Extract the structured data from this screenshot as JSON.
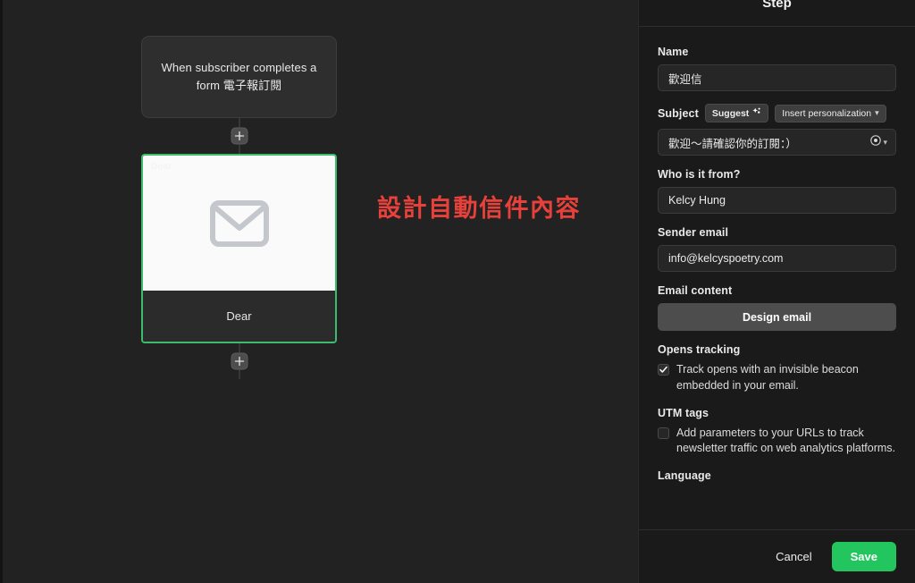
{
  "canvas": {
    "trigger_node": {
      "label": "When subscriber completes a form 電子報訂閱"
    },
    "add_step_top_label": "+",
    "add_step_bottom_label": "+",
    "email_node": {
      "preview_ghost_text": "Dear",
      "label": "Dear"
    },
    "annotation": "設計自動信件內容"
  },
  "panel": {
    "title": "Step",
    "name": {
      "label": "Name",
      "value": "歡迎信"
    },
    "subject": {
      "label": "Subject",
      "suggest_label": "Suggest",
      "personalization_label": "Insert personalization",
      "value": "歡迎～請確認你的訂閱：）"
    },
    "who_from": {
      "label": "Who is it from?",
      "value": "Kelcy Hung"
    },
    "sender_email": {
      "label": "Sender email",
      "value": "info@kelcyspoetry.com"
    },
    "email_content": {
      "label": "Email content",
      "design_button": "Design email"
    },
    "opens_tracking": {
      "label": "Opens tracking",
      "checkbox_text": "Track opens with an invisible beacon embedded in your email.",
      "checked": true
    },
    "utm_tags": {
      "label": "UTM tags",
      "checkbox_text": "Add parameters to your URLs to track newsletter traffic on web analytics platforms.",
      "checked": false
    },
    "language": {
      "label": "Language"
    },
    "footer": {
      "cancel_label": "Cancel",
      "save_label": "Save"
    }
  },
  "colors": {
    "accent_green": "#22c55e",
    "node_border_green": "#3bbd6d",
    "annotation_red": "#e8403a",
    "canvas_bg": "#222222",
    "panel_bg": "#1a1a1a"
  }
}
